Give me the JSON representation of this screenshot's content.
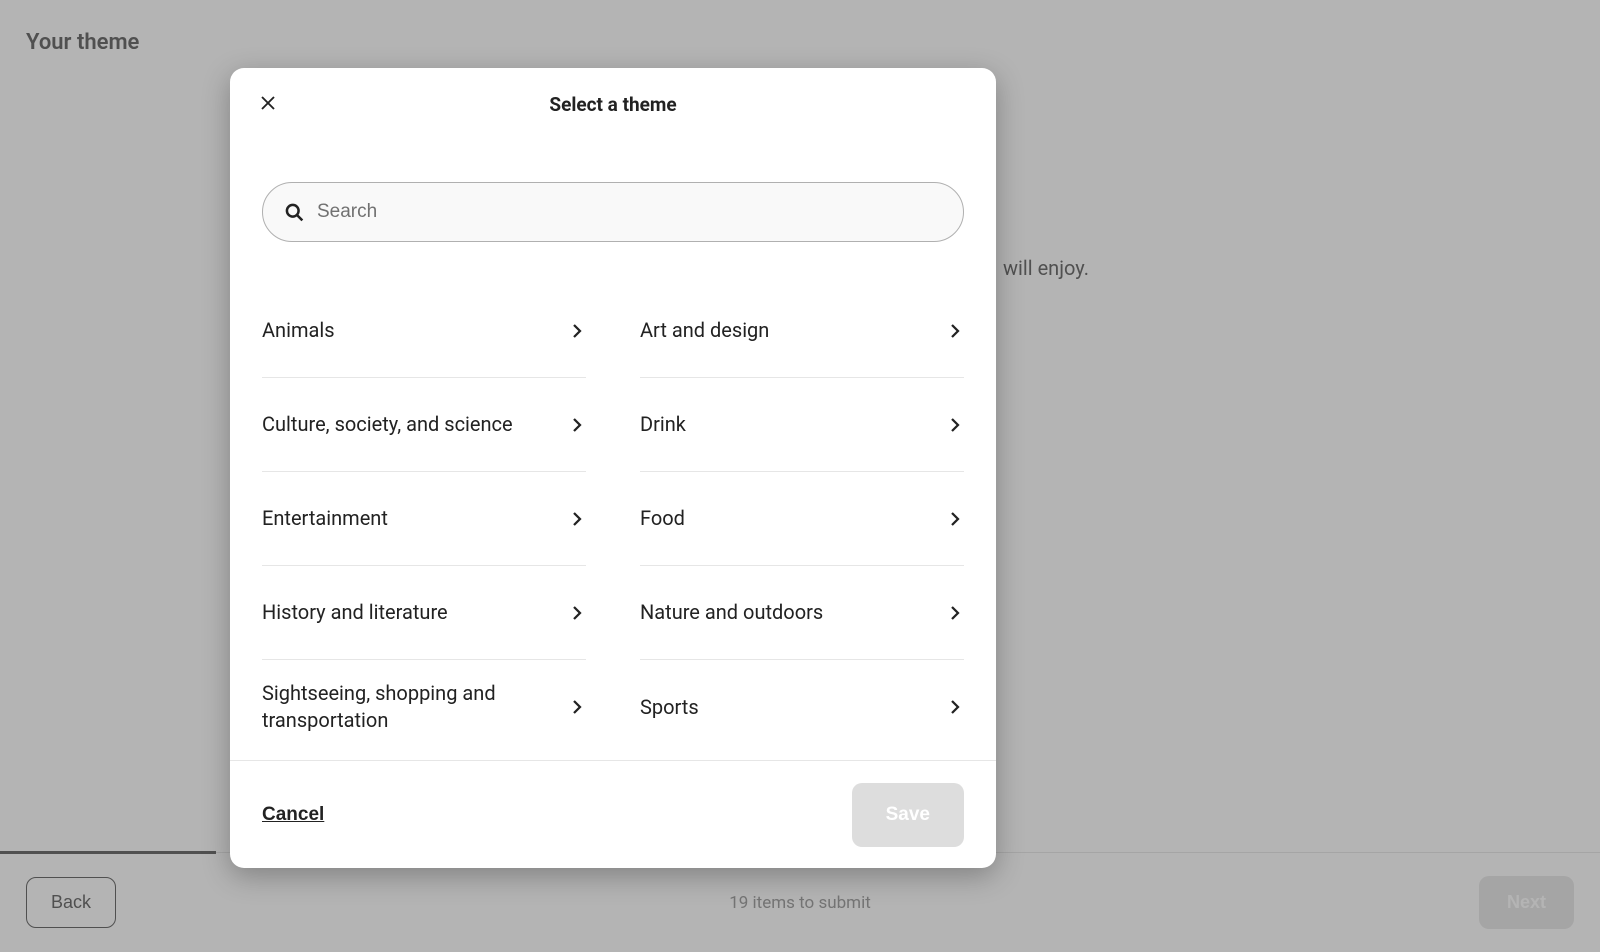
{
  "page": {
    "header": "Your theme",
    "subtitle_fragment": "will enjoy."
  },
  "modal": {
    "title": "Select a theme",
    "search_placeholder": "Search",
    "themes": [
      "Animals",
      "Art and design",
      "Culture, society, and science",
      "Drink",
      "Entertainment",
      "Food",
      "History and literature",
      "Nature and outdoors",
      "Sightseeing, shopping and transportation",
      "Sports"
    ],
    "cancel_label": "Cancel",
    "save_label": "Save"
  },
  "bottom_bar": {
    "back_label": "Back",
    "status_text": "19 items to submit",
    "next_label": "Next"
  }
}
